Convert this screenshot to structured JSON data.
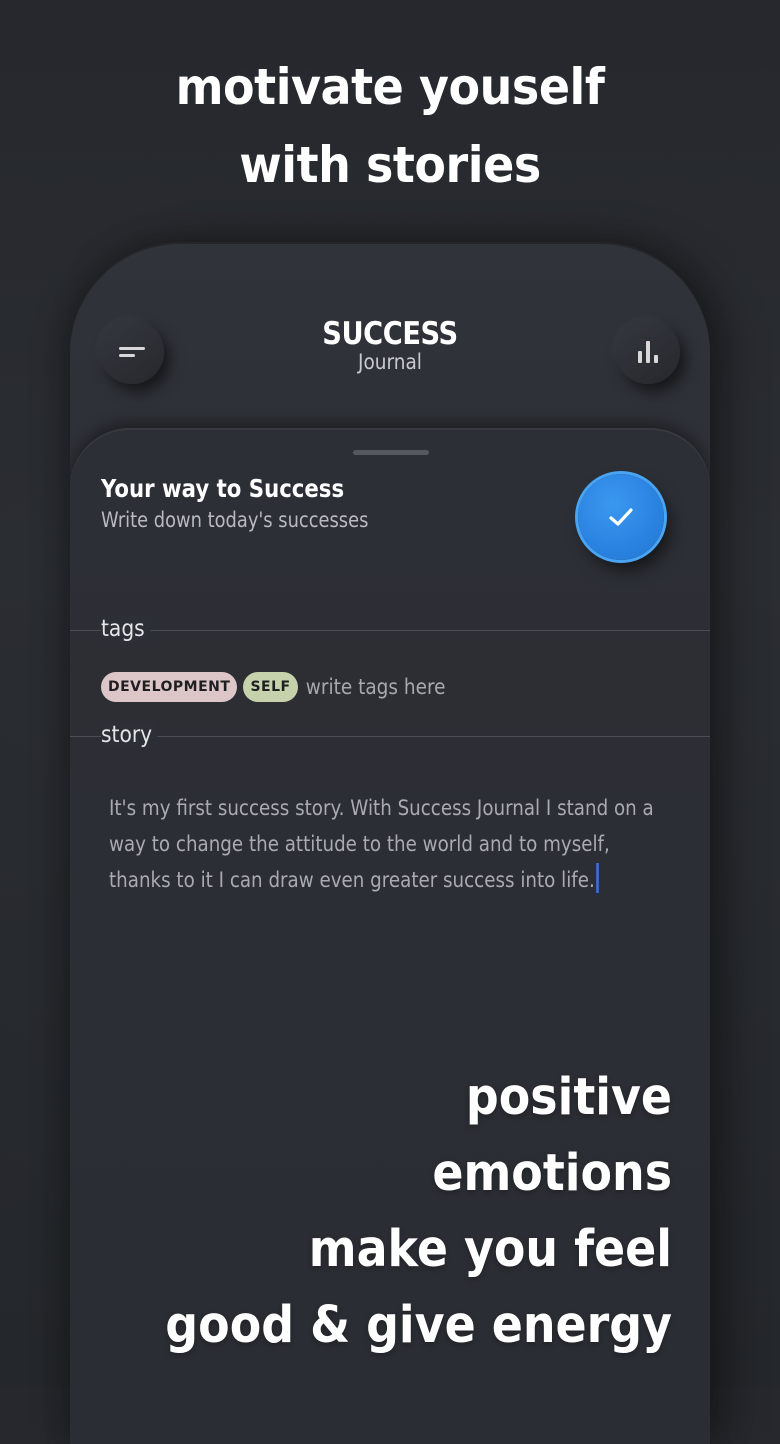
{
  "headline": {
    "line1": "motivate youself",
    "line2": "with stories"
  },
  "app": {
    "title": "SUCCESS",
    "subtitle": "Journal",
    "menu_icon": "menu-icon",
    "stats_icon": "bar-chart-icon"
  },
  "card": {
    "title": "Your way to Success",
    "subtitle": "Write down today's successes",
    "confirm_icon": "checkmark-icon",
    "confirm_color": "#2a82e0"
  },
  "tags": {
    "label": "tags",
    "items": [
      {
        "label": "DEVELOPMENT",
        "color": "#dcc6c8"
      },
      {
        "label": "SELF",
        "color": "#c6d2ac"
      }
    ],
    "placeholder": "write tags here"
  },
  "story": {
    "label": "story",
    "text": "It's my first success story. With Success Journal I stand on a way to change the attitude to the world and to myself, thanks to it I can draw even greater success into life."
  },
  "slogan": {
    "line1": "positive",
    "line2": "emotions",
    "line3": "make you feel",
    "line4": "good & give energy"
  }
}
